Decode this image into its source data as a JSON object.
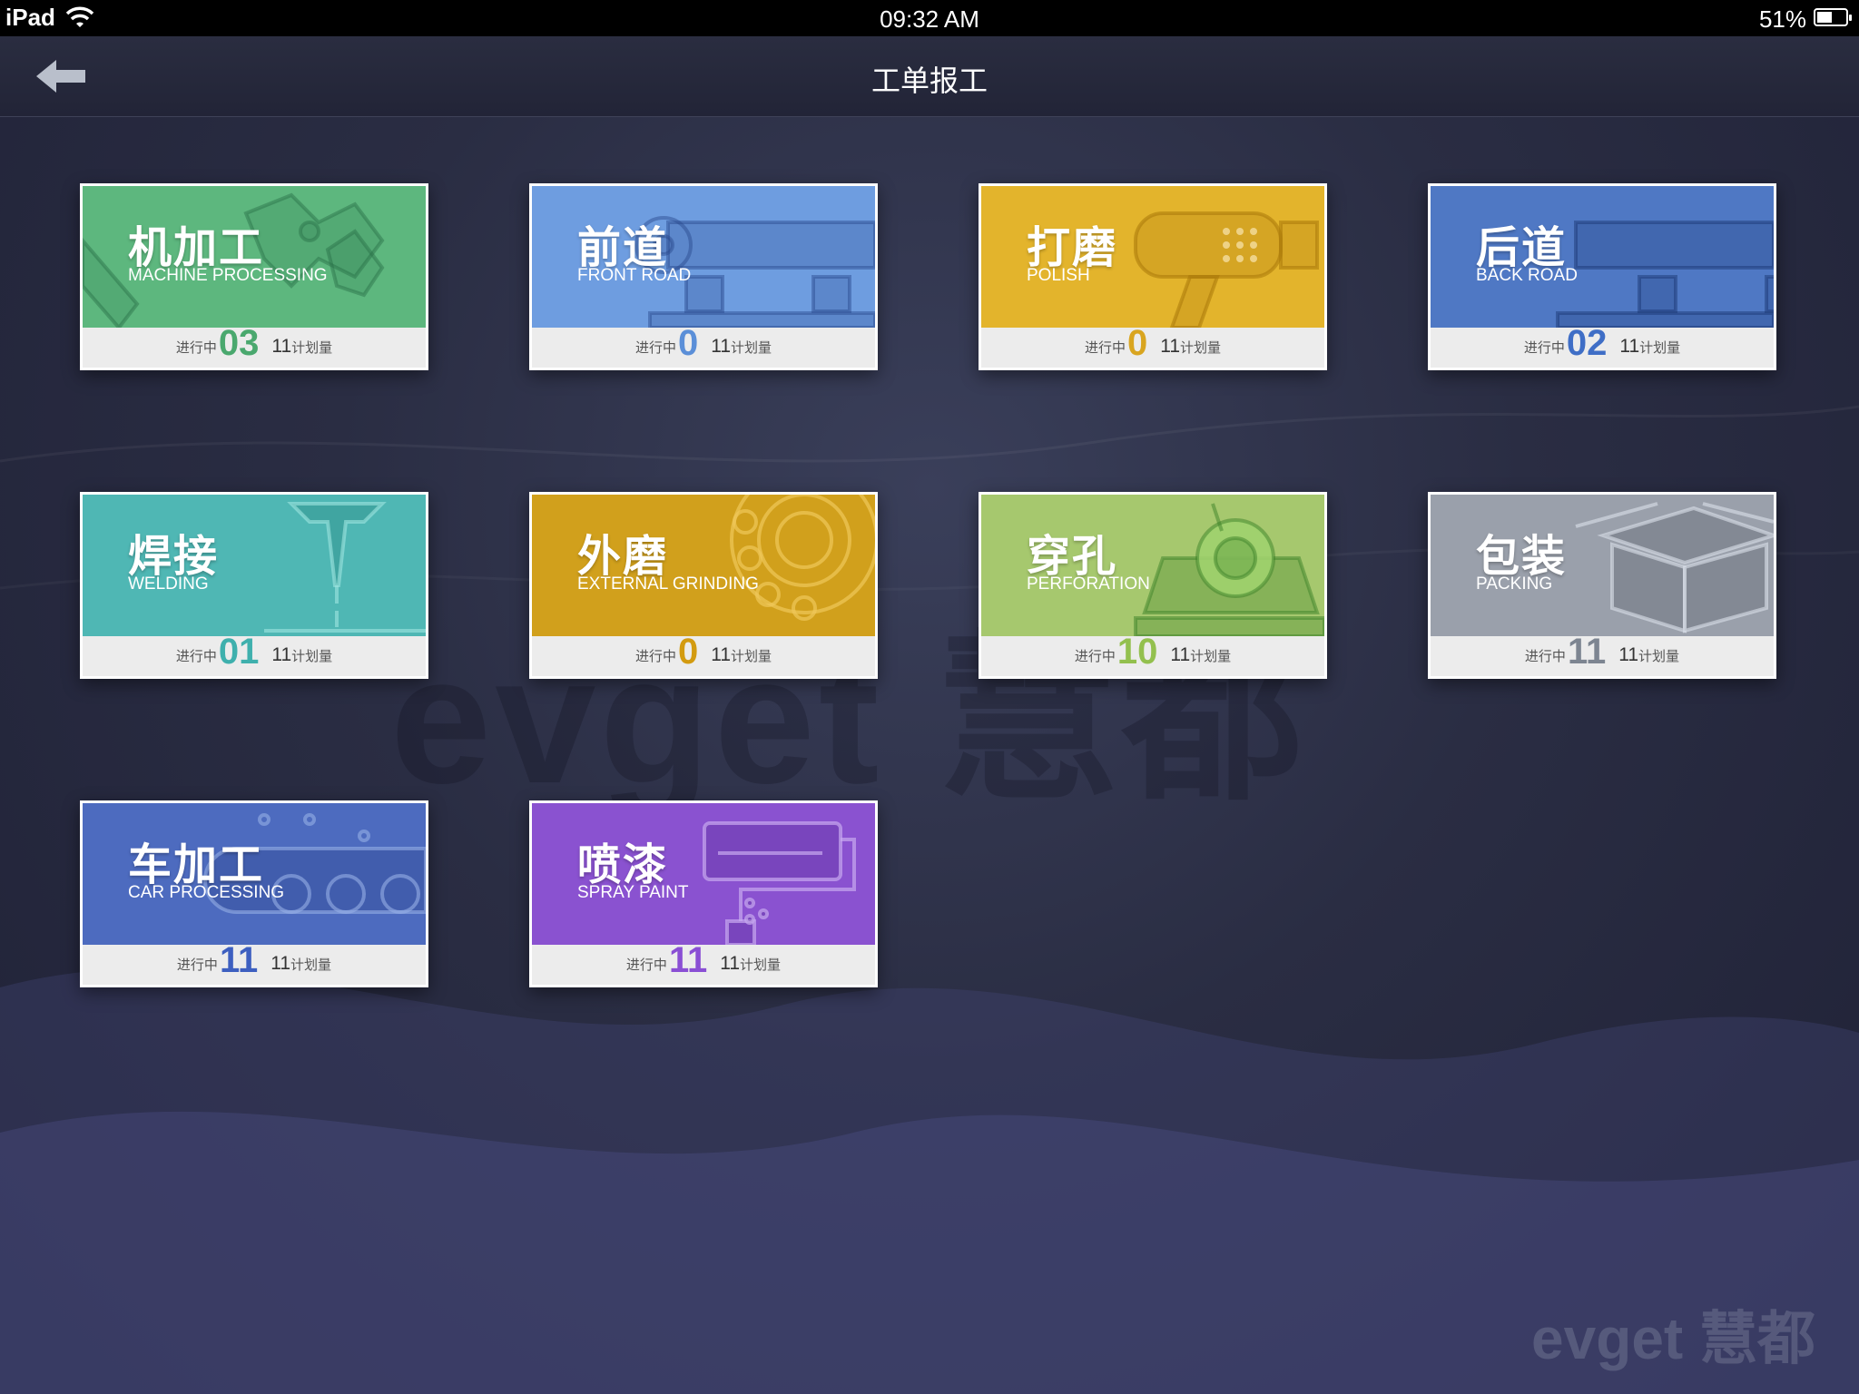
{
  "status_bar": {
    "device": "iPad",
    "time": "09:32 AM",
    "battery": "51%"
  },
  "nav": {
    "title": "工单报工"
  },
  "watermark": {
    "main": "evget 慧都",
    "corner": "evget 慧都"
  },
  "labels": {
    "in_progress": "进行中",
    "plan_qty": "计划量"
  },
  "tiles": [
    {
      "name": "机加工",
      "sub": "MACHINE PROCESSING",
      "in_progress": "03",
      "plan": "11",
      "color": "#5db77e",
      "num_color": "#4aa86e"
    },
    {
      "name": "前道",
      "sub": "FRONT ROAD",
      "in_progress": "0",
      "plan": "11",
      "color": "#6e9de0",
      "num_color": "#5b8fd8"
    },
    {
      "name": "打磨",
      "sub": "POLISH",
      "in_progress": "0",
      "plan": "11",
      "color": "#e3b42c",
      "num_color": "#d9a520"
    },
    {
      "name": "后道",
      "sub": "BACK ROAD",
      "in_progress": "02",
      "plan": "11",
      "color": "#4f78c4",
      "num_color": "#3f6ec6"
    },
    {
      "name": "焊接",
      "sub": "WELDING",
      "in_progress": "01",
      "plan": "11",
      "color": "#4fb7b4",
      "num_color": "#3fb0ad"
    },
    {
      "name": "外磨",
      "sub": "EXTERNAL GRINDING",
      "in_progress": "0",
      "plan": "11",
      "color": "#d1a01c",
      "num_color": "#d39b10"
    },
    {
      "name": "穿孔",
      "sub": "PERFORATION",
      "in_progress": "10",
      "plan": "11",
      "color": "#a6c86e",
      "num_color": "#93c04e"
    },
    {
      "name": "包装",
      "sub": "PACKING",
      "in_progress": "11",
      "plan": "11",
      "color": "#9aa0ab",
      "num_color": "#7d8591"
    },
    {
      "name": "车加工",
      "sub": "CAR PROCESSING",
      "in_progress": "11",
      "plan": "11",
      "color": "#4d6bbf",
      "num_color": "#3d5fc0"
    },
    {
      "name": "喷漆",
      "sub": "SPRAY PAINT",
      "in_progress": "11",
      "plan": "11",
      "color": "#8a52d0",
      "num_color": "#8a4fd4"
    }
  ]
}
